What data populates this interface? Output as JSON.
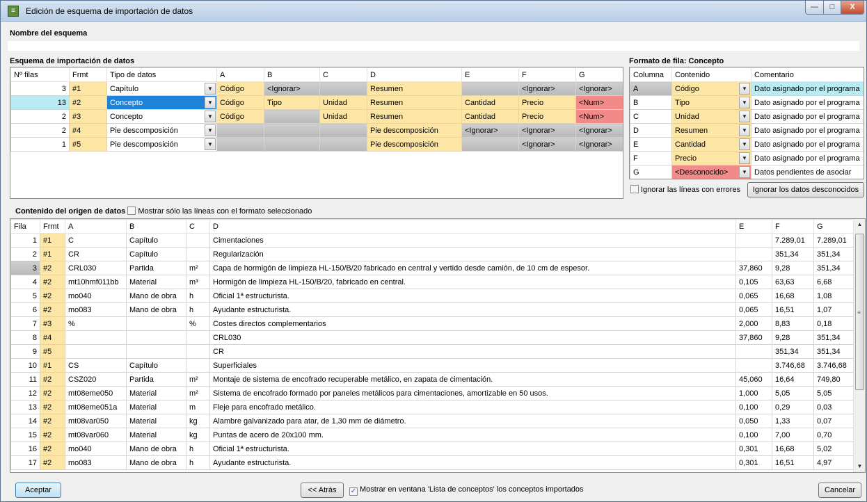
{
  "window": {
    "title": "Edición de esquema de importación de datos",
    "min": "—",
    "max": "□",
    "close": "X"
  },
  "name_label": "Nombre del esquema",
  "schema": {
    "title": "Esquema de importación de datos",
    "headers": [
      "Nº filas",
      "Frmt",
      "Tipo de datos",
      "A",
      "B",
      "C",
      "D",
      "E",
      "F",
      "G"
    ],
    "rows": [
      {
        "n": "3",
        "f": "#1",
        "t": "Capítulo",
        "c": [
          "Código",
          "<Ignorar>",
          "",
          "Resumen",
          "",
          "<Ignorar>",
          "<Ignorar>"
        ]
      },
      {
        "n": "13",
        "f": "#2",
        "t": "Concepto",
        "c": [
          "Código",
          "Tipo",
          "Unidad",
          "Resumen",
          "Cantidad",
          "Precio",
          "<Num>"
        ]
      },
      {
        "n": "2",
        "f": "#3",
        "t": "Concepto",
        "c": [
          "Código",
          "",
          "Unidad",
          "Resumen",
          "Cantidad",
          "Precio",
          "<Num>"
        ]
      },
      {
        "n": "2",
        "f": "#4",
        "t": "Pie descomposición",
        "c": [
          "",
          "",
          "",
          "Pie descomposición",
          "<Ignorar>",
          "<Ignorar>",
          "<Ignorar>"
        ]
      },
      {
        "n": "1",
        "f": "#5",
        "t": "Pie descomposición",
        "c": [
          "",
          "",
          "",
          "Pie descomposición",
          "",
          "<Ignorar>",
          "<Ignorar>"
        ]
      }
    ]
  },
  "format": {
    "title": "Formato de fila: Concepto",
    "headers": [
      "Columna",
      "Contenido",
      "Comentario"
    ],
    "rows": [
      {
        "col": "A",
        "content": "Código",
        "comment": "Dato asignado por el programa"
      },
      {
        "col": "B",
        "content": "Tipo",
        "comment": "Dato asignado por el programa"
      },
      {
        "col": "C",
        "content": "Unidad",
        "comment": "Dato asignado por el programa"
      },
      {
        "col": "D",
        "content": "Resumen",
        "comment": "Dato asignado por el programa"
      },
      {
        "col": "E",
        "content": "Cantidad",
        "comment": "Dato asignado por el programa"
      },
      {
        "col": "F",
        "content": "Precio",
        "comment": "Dato asignado por el programa"
      },
      {
        "col": "G",
        "content": "<Desconocido>",
        "comment": "Datos pendientes de asociar"
      }
    ],
    "ignore_errors_label": "Ignorar las líneas con errores",
    "ignore_unknown_button": "Ignorar los datos desconocidos"
  },
  "source": {
    "title": "Contenido del origen de datos",
    "filter_label": "Mostrar sólo las líneas con el formato seleccionado",
    "headers": [
      "Fila",
      "Frmt",
      "A",
      "B",
      "C",
      "D",
      "E",
      "F",
      "G"
    ],
    "rows": [
      [
        "1",
        "#1",
        "C",
        "Capítulo",
        "",
        "Cimentaciones",
        "",
        "7.289,01",
        "7.289,01"
      ],
      [
        "2",
        "#1",
        "CR",
        "Capítulo",
        "",
        "Regularización",
        "",
        "351,34",
        "351,34"
      ],
      [
        "3",
        "#2",
        "CRL030",
        "Partida",
        "m²",
        "Capa de hormigón de limpieza HL-150/B/20 fabricado en central y vertido desde camión, de 10 cm de espesor.",
        "37,860",
        "9,28",
        "351,34"
      ],
      [
        "4",
        "#2",
        "mt10hmf011bb",
        "Material",
        "m³",
        "Hormigón de limpieza HL-150/B/20, fabricado en central.",
        "0,105",
        "63,63",
        "6,68"
      ],
      [
        "5",
        "#2",
        "mo040",
        "Mano de obra",
        "h",
        "Oficial 1ª estructurista.",
        "0,065",
        "16,68",
        "1,08"
      ],
      [
        "6",
        "#2",
        "mo083",
        "Mano de obra",
        "h",
        "Ayudante estructurista.",
        "0,065",
        "16,51",
        "1,07"
      ],
      [
        "7",
        "#3",
        "%",
        "",
        "%",
        "Costes directos complementarios",
        "2,000",
        "8,83",
        "0,18"
      ],
      [
        "8",
        "#4",
        "",
        "",
        "",
        "CRL030",
        "37,860",
        "9,28",
        "351,34"
      ],
      [
        "9",
        "#5",
        "",
        "",
        "",
        "CR",
        "",
        "351,34",
        "351,34"
      ],
      [
        "10",
        "#1",
        "CS",
        "Capítulo",
        "",
        "Superficiales",
        "",
        "3.746,68",
        "3.746,68"
      ],
      [
        "11",
        "#2",
        "CSZ020",
        "Partida",
        "m²",
        "Montaje de sistema de encofrado recuperable metálico, en zapata de cimentación.",
        "45,060",
        "16,64",
        "749,80"
      ],
      [
        "12",
        "#2",
        "mt08eme050",
        "Material",
        "m²",
        "Sistema de encofrado formado por paneles metálicos para cimentaciones, amortizable en 50 usos.",
        "1,000",
        "5,05",
        "5,05"
      ],
      [
        "13",
        "#2",
        "mt08eme051a",
        "Material",
        "m",
        "Fleje para encofrado metálico.",
        "0,100",
        "0,29",
        "0,03"
      ],
      [
        "14",
        "#2",
        "mt08var050",
        "Material",
        "kg",
        "Alambre galvanizado para atar, de 1,30 mm de diámetro.",
        "0,050",
        "1,33",
        "0,07"
      ],
      [
        "15",
        "#2",
        "mt08var060",
        "Material",
        "kg",
        "Puntas de acero de 20x100 mm.",
        "0,100",
        "7,00",
        "0,70"
      ],
      [
        "16",
        "#2",
        "mo040",
        "Mano de obra",
        "h",
        "Oficial 1ª estructurista.",
        "0,301",
        "16,68",
        "5,02"
      ],
      [
        "17",
        "#2",
        "mo083",
        "Mano de obra",
        "h",
        "Ayudante estructurista.",
        "0,301",
        "16,51",
        "4,97"
      ]
    ]
  },
  "footer": {
    "accept": "Aceptar",
    "back": "<< Atrás",
    "show_label": "Mostrar en ventana 'Lista de conceptos' los conceptos importados",
    "cancel": "Cancelar"
  }
}
